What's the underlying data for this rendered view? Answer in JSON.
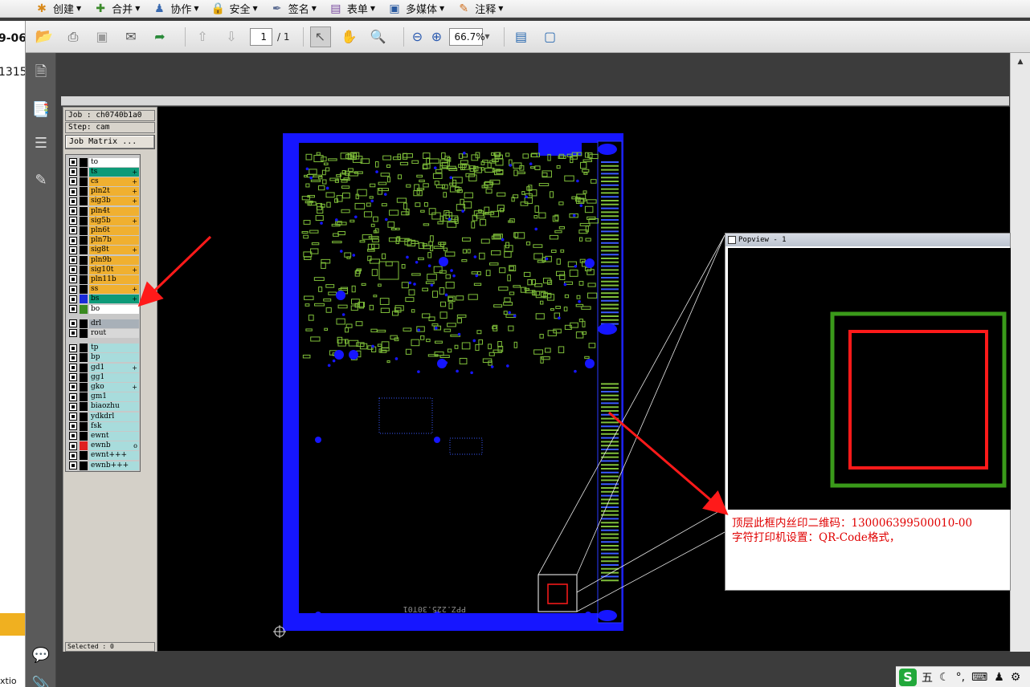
{
  "menubar": {
    "items": [
      {
        "label": "创建",
        "icon": "create-icon",
        "color": "#d88a1c"
      },
      {
        "label": "合并",
        "icon": "combine-icon",
        "color": "#3a8a2a"
      },
      {
        "label": "协作",
        "icon": "collaborate-icon",
        "color": "#3a6ab0"
      },
      {
        "label": "安全",
        "icon": "lock-icon",
        "color": "#c8a020"
      },
      {
        "label": "签名",
        "icon": "pen-icon",
        "color": "#5a6a90"
      },
      {
        "label": "表单",
        "icon": "form-icon",
        "color": "#7a4aa0"
      },
      {
        "label": "多媒体",
        "icon": "multimedia-icon",
        "color": "#2a5aa0"
      },
      {
        "label": "注释",
        "icon": "comment-icon",
        "color": "#d07020"
      }
    ]
  },
  "toolbar": {
    "page_current": "1",
    "page_total": "/ 1",
    "zoom": "66.7%"
  },
  "left_window": {
    "fragment_1": "9-06",
    "fragment_2": "1315",
    "fragment_3": "xtio"
  },
  "job_panel": {
    "job": "Job : ch0740b1a0",
    "step": "Step: cam",
    "matrix_button": "Job Matrix ...",
    "selected": "Selected : 0",
    "layers": [
      {
        "name": "to",
        "bg": "#ffffff",
        "swatch": "#000000",
        "mark": ""
      },
      {
        "name": "ts",
        "bg": "#0e9a78",
        "swatch": "#000000",
        "mark": "+"
      },
      {
        "name": "cs",
        "bg": "#f0b030",
        "swatch": "#000000",
        "mark": "+"
      },
      {
        "name": "pln2t",
        "bg": "#f0b030",
        "swatch": "#000000",
        "mark": "+"
      },
      {
        "name": "sig3b",
        "bg": "#f0b030",
        "swatch": "#000000",
        "mark": "+"
      },
      {
        "name": "pln4t",
        "bg": "#f0b030",
        "swatch": "#000000",
        "mark": ""
      },
      {
        "name": "sig5b",
        "bg": "#f0b030",
        "swatch": "#000000",
        "mark": "+"
      },
      {
        "name": "pln6t",
        "bg": "#f0b030",
        "swatch": "#000000",
        "mark": ""
      },
      {
        "name": "pln7b",
        "bg": "#f0b030",
        "swatch": "#000000",
        "mark": ""
      },
      {
        "name": "sig8t",
        "bg": "#f0b030",
        "swatch": "#000000",
        "mark": "+"
      },
      {
        "name": "pln9b",
        "bg": "#f0b030",
        "swatch": "#000000",
        "mark": ""
      },
      {
        "name": "sig10t",
        "bg": "#f0b030",
        "swatch": "#000000",
        "mark": "+"
      },
      {
        "name": "pln11b",
        "bg": "#f0b030",
        "swatch": "#000000",
        "mark": ""
      },
      {
        "name": "ss",
        "bg": "#f0b030",
        "swatch": "#000000",
        "mark": "+"
      },
      {
        "name": "bs",
        "bg": "#0e9a78",
        "swatch": "#1a2ad8",
        "mark": "+"
      },
      {
        "name": "bo",
        "bg": "#ffffff",
        "swatch": "#3a8a20",
        "mark": ""
      },
      {
        "name": "drl",
        "bg": "#a8b0b8",
        "swatch": "#000000",
        "mark": ""
      },
      {
        "name": "rout",
        "bg": "#d8d8d8",
        "swatch": "#000000",
        "mark": ""
      },
      {
        "name": "tp",
        "bg": "#a8dcdc",
        "swatch": "#000000",
        "mark": ""
      },
      {
        "name": "bp",
        "bg": "#a8dcdc",
        "swatch": "#000000",
        "mark": ""
      },
      {
        "name": "gd1",
        "bg": "#a8dcdc",
        "swatch": "#000000",
        "mark": "+"
      },
      {
        "name": "gg1",
        "bg": "#a8dcdc",
        "swatch": "#000000",
        "mark": ""
      },
      {
        "name": "gko",
        "bg": "#a8dcdc",
        "swatch": "#000000",
        "mark": "+"
      },
      {
        "name": "gm1",
        "bg": "#a8dcdc",
        "swatch": "#000000",
        "mark": ""
      },
      {
        "name": "biaozhu",
        "bg": "#a8dcdc",
        "swatch": "#000000",
        "mark": ""
      },
      {
        "name": "ydkdrl",
        "bg": "#a8dcdc",
        "swatch": "#000000",
        "mark": ""
      },
      {
        "name": "fsk",
        "bg": "#a8dcdc",
        "swatch": "#000000",
        "mark": ""
      },
      {
        "name": "ewnt",
        "bg": "#a8dcdc",
        "swatch": "#000000",
        "mark": ""
      },
      {
        "name": "ewnb",
        "bg": "#a8dcdc",
        "swatch": "#e02020",
        "mark": "o"
      },
      {
        "name": "ewnt+++",
        "bg": "#a8dcdc",
        "swatch": "#000000",
        "mark": ""
      },
      {
        "name": "ewnb+++",
        "bg": "#a8dcdc",
        "swatch": "#000000",
        "mark": ""
      }
    ]
  },
  "board": {
    "silk_text": "PPZ.225.30T01"
  },
  "popup": {
    "title": "Popview - 1",
    "note_line1": "顶层此框内丝印二维码：130006399500010-00",
    "note_line2": "字符打印机设置：QR-Code格式，"
  },
  "tray": {
    "logo": "S",
    "ime": "五"
  },
  "colors": {
    "board_blue": "#1616ff",
    "trace_green": "#7fbf3a",
    "annotation_red": "#ff1a1a",
    "frame_green": "#3a9a1a"
  }
}
